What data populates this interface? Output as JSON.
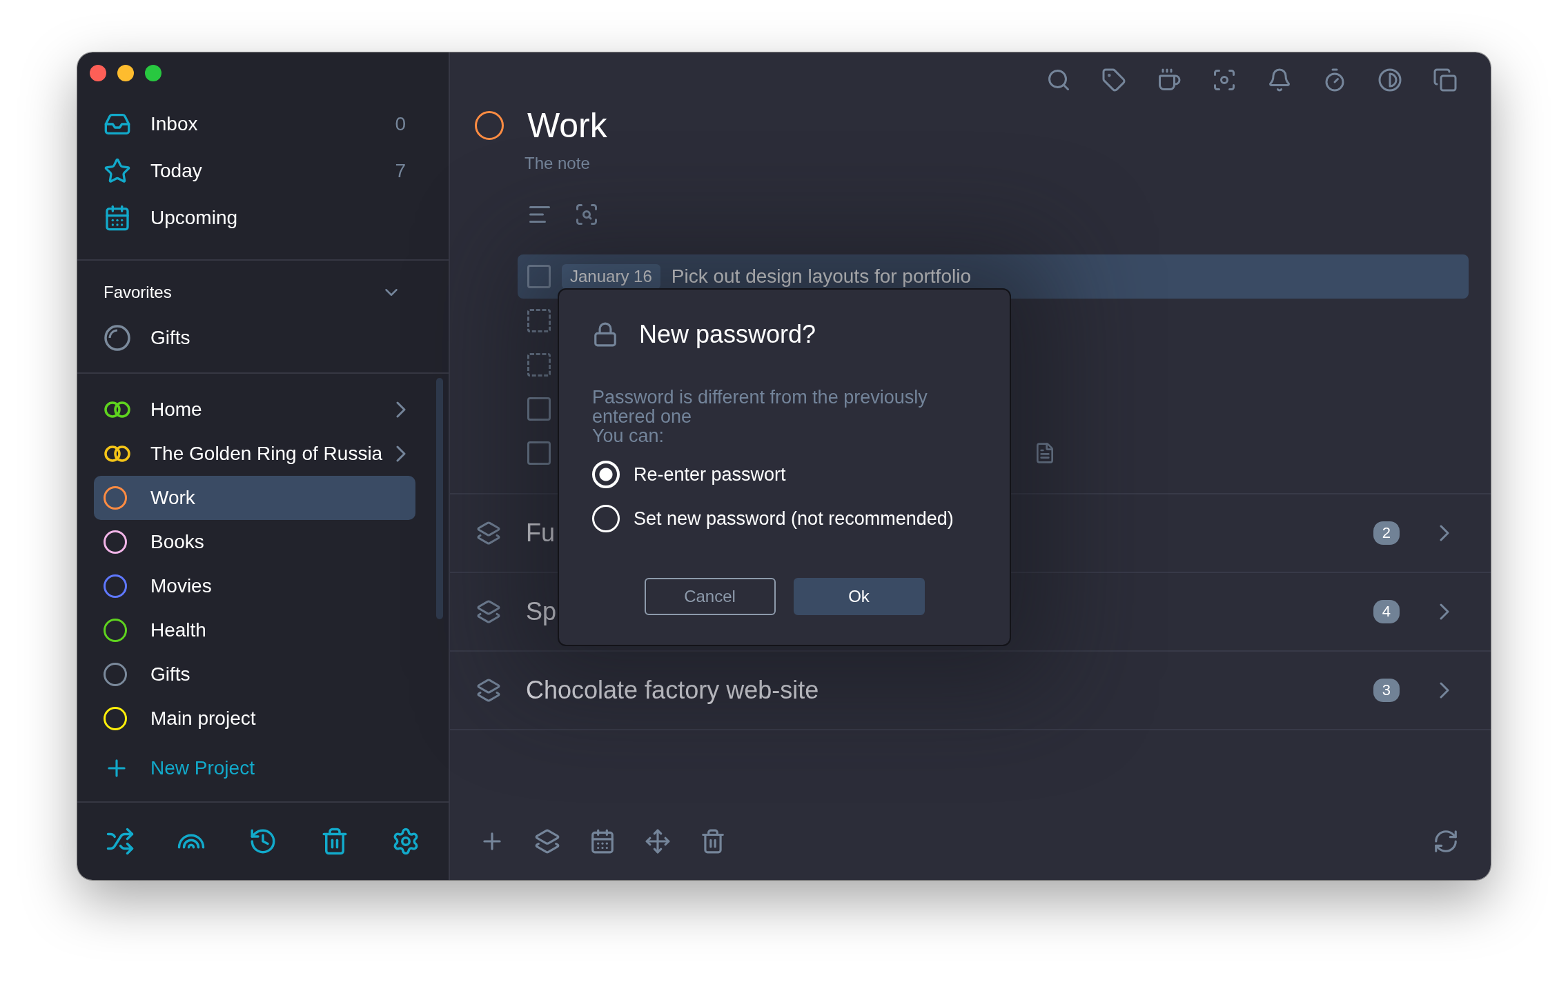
{
  "window": {
    "traffic_lights": [
      {
        "color": "#fe5f57"
      },
      {
        "color": "#febc2e"
      },
      {
        "color": "#28c840"
      }
    ]
  },
  "sidebar": {
    "nav": [
      {
        "kind": "inbox",
        "label": "Inbox",
        "count": "0"
      },
      {
        "kind": "today",
        "label": "Today",
        "count": "7"
      },
      {
        "kind": "upcoming",
        "label": "Upcoming"
      }
    ],
    "favorites": {
      "title": "Favorites",
      "expanded": true,
      "items": [
        {
          "kind": "progress",
          "label": "Gifts",
          "color": "#7b8a9c"
        }
      ]
    },
    "projects": [
      {
        "kind": "area",
        "label": "Home",
        "color": "#5fd31f",
        "selected": false
      },
      {
        "kind": "area",
        "label": "The Golden Ring of Russia",
        "color": "#f5c518",
        "selected": false
      },
      {
        "kind": "project",
        "label": "Work",
        "color": "#ff8c42",
        "selected": true
      },
      {
        "kind": "project",
        "label": "Books",
        "color": "#f2b5e8",
        "selected": false
      },
      {
        "kind": "project",
        "label": "Movies",
        "color": "#5f78ff",
        "selected": false
      },
      {
        "kind": "project",
        "label": "Health",
        "color": "#5fd31f",
        "selected": false
      },
      {
        "kind": "project",
        "label": "Gifts",
        "color": "#7b8a9c",
        "selected": false
      },
      {
        "kind": "project",
        "label": "Main project",
        "color": "#ffef0a",
        "selected": false
      }
    ],
    "new_project": {
      "label": "New Project"
    }
  },
  "main": {
    "title": "Work",
    "color": "#ff8c42",
    "note": "The note",
    "tasks": [
      {
        "kind": "task",
        "checked": false,
        "selected": true,
        "date": "January 16",
        "title": "Pick out design layouts for portfolio",
        "has_note": false
      },
      {
        "kind": "placeholder",
        "checked": false,
        "selected": false,
        "has_note": false
      },
      {
        "kind": "placeholder",
        "checked": false,
        "selected": false,
        "has_note": false
      },
      {
        "kind": "task",
        "checked": false,
        "selected": false,
        "has_note": false
      },
      {
        "kind": "task",
        "checked": false,
        "selected": false,
        "has_note": true
      }
    ],
    "headings": [
      {
        "title": "Fu",
        "count": "2"
      },
      {
        "title": "Sp",
        "count": "4"
      },
      {
        "title": "Chocolate factory web-site",
        "count": "3"
      }
    ]
  },
  "dialog": {
    "title": "New password?",
    "message": "Password is different from the previously entered one",
    "prompt": "You can:",
    "options": [
      {
        "label": "Re-enter passwort",
        "selected": true
      },
      {
        "label": "Set new password (not recommended)",
        "selected": false
      }
    ],
    "buttons": [
      {
        "kind": "secondary",
        "label": "Cancel"
      },
      {
        "kind": "primary",
        "label": "Ok"
      }
    ]
  }
}
